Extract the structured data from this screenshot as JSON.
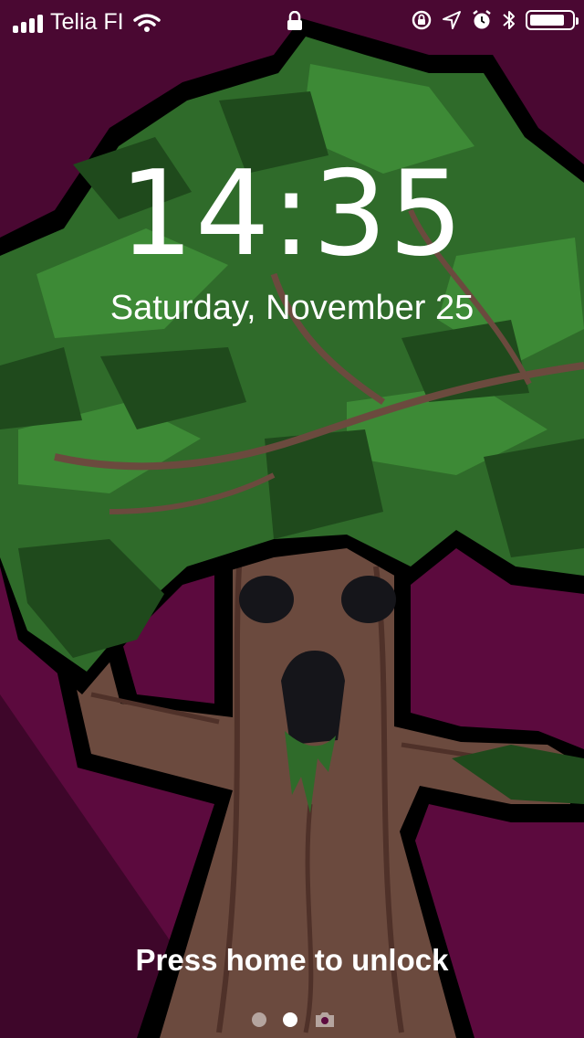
{
  "status_bar": {
    "carrier": "Telia FI",
    "signal_bars": 4,
    "battery_level": 0.85,
    "icons": [
      "signal-icon",
      "wifi-icon",
      "lock-icon",
      "rotation-lock-icon",
      "location-icon",
      "alarm-icon",
      "bluetooth-icon",
      "battery-icon"
    ]
  },
  "lock_screen": {
    "time": "14:35",
    "date": "Saturday, November 25",
    "unlock_hint": "Press home to unlock",
    "pages": [
      "dot",
      "dot-active",
      "camera"
    ]
  },
  "colors": {
    "background": "#5a0a3c",
    "foliage_dark": "#1f4a1c",
    "foliage_mid": "#2f6b2a",
    "foliage_light": "#3d8a36",
    "trunk": "#6b4a3e",
    "outline": "#000000"
  }
}
